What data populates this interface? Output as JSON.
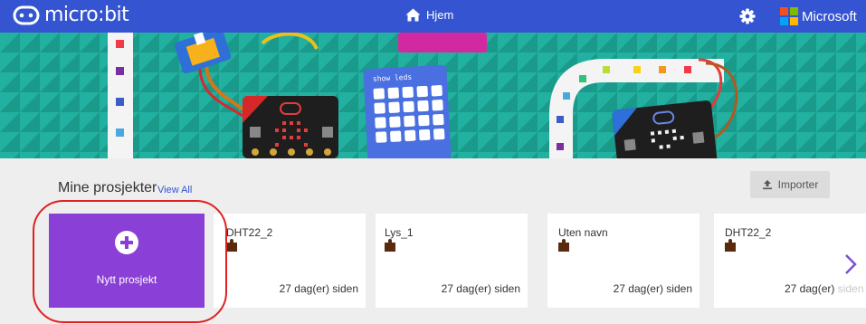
{
  "app": {
    "brand": "micro:bit",
    "home_label": "Hjem",
    "microsoft_label": "Microsoft",
    "colors": {
      "topbar": "#3454d1",
      "new_project": "#8a3fd6",
      "hero_bg": "#1fa697"
    }
  },
  "icons": {
    "home": "home-icon",
    "settings": "gear-icon",
    "import": "upload-icon",
    "new": "plus-circle-icon",
    "project": "puzzle-piece-icon",
    "next": "chevron-right-icon"
  },
  "projects": {
    "section_title": "Mine prosjekter",
    "view_all": "View All",
    "import_label": "Importer",
    "new_project_label": "Nytt prosjekt",
    "cards": [
      {
        "name": "DHT22_2",
        "time": "27 dag(er) siden"
      },
      {
        "name": "Lys_1",
        "time": "27 dag(er) siden"
      },
      {
        "name": "Uten navn",
        "time": "27 dag(er) siden"
      },
      {
        "name": "DHT22_2",
        "time_main": "27 dag(er)",
        "time_faded": " siden"
      }
    ]
  },
  "hero": {
    "code_label": "show leds"
  }
}
